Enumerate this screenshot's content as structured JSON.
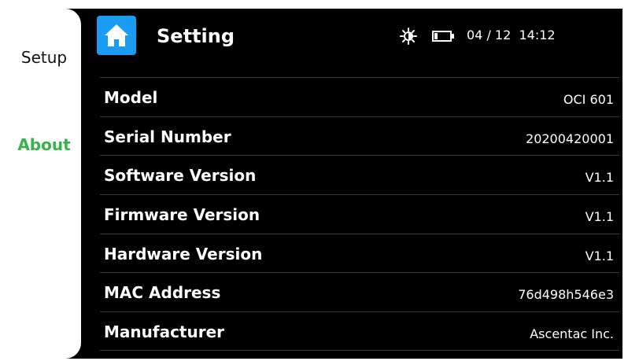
{
  "sidebar": {
    "items": [
      {
        "label": "Setup"
      },
      {
        "label": "About"
      }
    ]
  },
  "header": {
    "title": "Setting",
    "icons": [
      "home-icon",
      "brightness-icon",
      "battery-icon"
    ],
    "date": "04 / 12",
    "time": "14:12"
  },
  "about": {
    "rows": [
      {
        "label": "Model",
        "value": "OCI 601"
      },
      {
        "label": "Serial Number",
        "value": "20200420001"
      },
      {
        "label": "Software Version",
        "value": "V1.1"
      },
      {
        "label": "Firmware Version",
        "value": "V1.1"
      },
      {
        "label": "Hardware Version",
        "value": "V1.1"
      },
      {
        "label": "MAC Address",
        "value": "76d498h546e3"
      },
      {
        "label": "Manufacturer",
        "value": "Ascentac Inc."
      }
    ]
  },
  "colors": {
    "accent_green": "#39b24a",
    "home_blue": "#1a9cf2",
    "background": "#000000"
  }
}
